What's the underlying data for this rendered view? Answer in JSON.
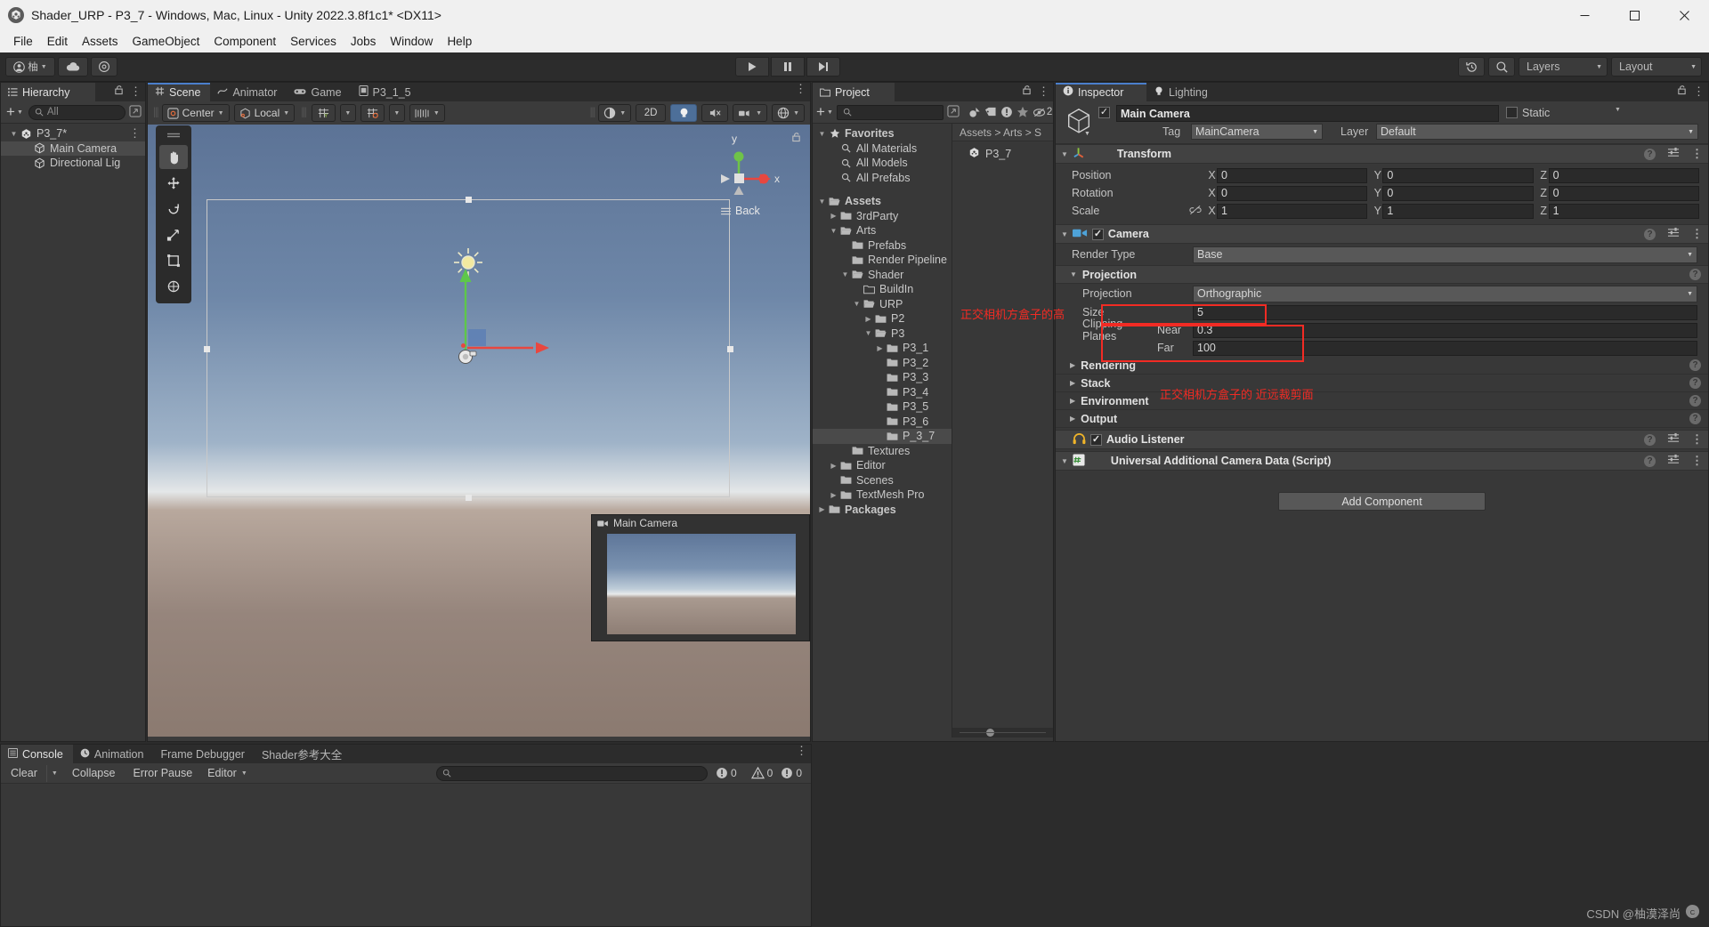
{
  "window": {
    "title": "Shader_URP - P3_7 - Windows, Mac, Linux - Unity 2022.3.8f1c1* <DX11>",
    "minimize": "—",
    "maximize": "❐",
    "close": "✕"
  },
  "menu": {
    "items": [
      "File",
      "Edit",
      "Assets",
      "GameObject",
      "Component",
      "Services",
      "Jobs",
      "Window",
      "Help"
    ]
  },
  "toolbar": {
    "account_icon": "account-icon",
    "account_label": "柚",
    "cloud_icon": "cloud-icon",
    "settings_icon": "gear-icon",
    "play_icon": "▶",
    "pause_icon": "❚❚",
    "step_icon": "▶❙",
    "history_icon": "undo-history-icon",
    "search_icon": "search-icon",
    "layers_label": "Layers",
    "layout_label": "Layout"
  },
  "hierarchy": {
    "tab_label": "Hierarchy",
    "lock_icon": "lock-icon",
    "menu_icon": "kebab-menu-icon",
    "add_label": "+",
    "search_placeholder": "All",
    "items": [
      {
        "label": "P3_7*",
        "icon": "unity-scene-icon",
        "depth": 0,
        "expanded": true,
        "selected": false
      },
      {
        "label": "Main Camera",
        "icon": "gameobject-icon",
        "depth": 1,
        "selected": true
      },
      {
        "label": "Directional Lig",
        "icon": "gameobject-icon",
        "depth": 1,
        "selected": false
      }
    ]
  },
  "scene": {
    "tabs": [
      {
        "label": "Scene",
        "icon": "scene-icon",
        "active": true
      },
      {
        "label": "Animator",
        "icon": "animator-icon",
        "active": false
      },
      {
        "label": "Game",
        "icon": "gamepad-icon",
        "active": false
      },
      {
        "label": "P3_1_5",
        "icon": "asset-icon",
        "active": false
      }
    ],
    "toolbar": {
      "pivot_label": "Center",
      "handle_label": "Local",
      "grid_icon": "grid-axis-icon",
      "snap_icon": "snap-increment-icon",
      "ruler_icon": "ruler-icon",
      "shading_icon": "shading-mode-icon",
      "two_d_label": "2D",
      "light_icon": "lightbulb-icon",
      "audio_icon": "audio-mute-icon",
      "fx_icon": "effects-icon",
      "gizmo_icon": "gizmo-visibility-icon",
      "camera_icon": "scene-camera-icon"
    },
    "tools": [
      "hand-tool",
      "move-tool",
      "rotate-tool",
      "scale-tool",
      "rect-tool",
      "transform-tool"
    ],
    "gizmo": {
      "x_label": "x",
      "y_label": "y",
      "view_label": "Back",
      "lock_icon": "lock-icon"
    },
    "preview": {
      "title": "Main Camera",
      "icon": "camera-icon"
    }
  },
  "project": {
    "tab_label": "Project",
    "lock_icon": "lock-icon",
    "menu_icon": "kebab-menu-icon",
    "add_label": "+",
    "search_placeholder": "",
    "filter_icons": [
      "asset-type-icon",
      "label-icon",
      "warning-icon",
      "favorite-star-icon",
      "hidden-count-icon"
    ],
    "hidden_count": "2",
    "breadcrumb": "Assets > Arts > S",
    "grid_items": [
      {
        "label": "P3_7",
        "icon": "unity-scene-icon"
      }
    ],
    "tree": [
      {
        "label": "Favorites",
        "depth": 0,
        "arrow": "down",
        "icon": "star-icon",
        "bold": true
      },
      {
        "label": "All Materials",
        "depth": 1,
        "arrow": "none",
        "icon": "search-icon"
      },
      {
        "label": "All Models",
        "depth": 1,
        "arrow": "none",
        "icon": "search-icon"
      },
      {
        "label": "All Prefabs",
        "depth": 1,
        "arrow": "none",
        "icon": "search-icon"
      },
      {
        "label": "",
        "depth": 0,
        "arrow": "none",
        "icon": "spacer"
      },
      {
        "label": "Assets",
        "depth": 0,
        "arrow": "down",
        "icon": "folder-open-icon",
        "bold": true
      },
      {
        "label": "3rdParty",
        "depth": 1,
        "arrow": "right",
        "icon": "folder-icon"
      },
      {
        "label": "Arts",
        "depth": 1,
        "arrow": "down",
        "icon": "folder-open-icon"
      },
      {
        "label": "Prefabs",
        "depth": 2,
        "arrow": "none",
        "icon": "folder-icon"
      },
      {
        "label": "Render Pipeline",
        "depth": 2,
        "arrow": "none",
        "icon": "folder-icon"
      },
      {
        "label": "Shader",
        "depth": 2,
        "arrow": "down",
        "icon": "folder-open-icon"
      },
      {
        "label": "BuildIn",
        "depth": 3,
        "arrow": "none",
        "icon": "folder-empty-icon"
      },
      {
        "label": "URP",
        "depth": 3,
        "arrow": "down",
        "icon": "folder-open-icon"
      },
      {
        "label": "P2",
        "depth": 4,
        "arrow": "right",
        "icon": "folder-icon"
      },
      {
        "label": "P3",
        "depth": 4,
        "arrow": "down",
        "icon": "folder-open-icon"
      },
      {
        "label": "P3_1",
        "depth": 5,
        "arrow": "right",
        "icon": "folder-icon"
      },
      {
        "label": "P3_2",
        "depth": 5,
        "arrow": "none",
        "icon": "folder-icon"
      },
      {
        "label": "P3_3",
        "depth": 5,
        "arrow": "none",
        "icon": "folder-icon"
      },
      {
        "label": "P3_4",
        "depth": 5,
        "arrow": "none",
        "icon": "folder-icon"
      },
      {
        "label": "P3_5",
        "depth": 5,
        "arrow": "none",
        "icon": "folder-icon"
      },
      {
        "label": "P3_6",
        "depth": 5,
        "arrow": "none",
        "icon": "folder-icon"
      },
      {
        "label": "P_3_7",
        "depth": 5,
        "arrow": "none",
        "icon": "folder-icon",
        "selected": true
      },
      {
        "label": "Textures",
        "depth": 2,
        "arrow": "none",
        "icon": "folder-icon"
      },
      {
        "label": "Editor",
        "depth": 1,
        "arrow": "right",
        "icon": "folder-icon"
      },
      {
        "label": "Scenes",
        "depth": 1,
        "arrow": "none",
        "icon": "folder-icon"
      },
      {
        "label": "TextMesh Pro",
        "depth": 1,
        "arrow": "right",
        "icon": "folder-icon"
      },
      {
        "label": "Packages",
        "depth": 0,
        "arrow": "right",
        "icon": "folder-icon",
        "bold": true
      }
    ]
  },
  "inspector": {
    "tabs": [
      {
        "label": "Inspector",
        "icon": "info-icon",
        "active": true
      },
      {
        "label": "Lighting",
        "icon": "lighting-icon",
        "active": false
      }
    ],
    "lock_icon": "lock-icon",
    "menu_icon": "kebab-menu-icon",
    "object_icon": "gameobject-cube-icon",
    "enabled": true,
    "name": "Main Camera",
    "static_label": "Static",
    "tag_label": "Tag",
    "tag_value": "MainCamera",
    "layer_label": "Layer",
    "layer_value": "Default",
    "transform": {
      "title": "Transform",
      "icon": "transform-axis-icon",
      "rows": [
        {
          "label": "Position",
          "x": "0",
          "y": "0",
          "z": "0"
        },
        {
          "label": "Rotation",
          "x": "0",
          "y": "0",
          "z": "0"
        },
        {
          "label": "Scale",
          "x": "1",
          "y": "1",
          "z": "1",
          "link_icon": "link-broken-icon"
        }
      ],
      "axis_labels": [
        "X",
        "Y",
        "Z"
      ]
    },
    "camera": {
      "title": "Camera",
      "icon": "camera-icon",
      "enabled": true,
      "render_type_label": "Render Type",
      "render_type_value": "Base",
      "projection_group_label": "Projection",
      "projection_label": "Projection",
      "projection_value": "Orthographic",
      "size_label": "Size",
      "size_value": "5",
      "clipping_label": "Clipping Planes",
      "near_label": "Near",
      "near_value": "0.3",
      "far_label": "Far",
      "far_value": "100",
      "foldouts": [
        "Rendering",
        "Stack",
        "Environment",
        "Output"
      ]
    },
    "audio_listener": {
      "title": "Audio Listener",
      "icon": "headphones-icon",
      "enabled": true
    },
    "script": {
      "title": "Universal Additional Camera Data (Script)",
      "icon": "script-icon"
    },
    "add_component_label": "Add Component"
  },
  "annotations": [
    {
      "text": "正交相机方盒子的高",
      "name": "annotation-ortho-size"
    },
    {
      "text": "正交相机方盒子的 近远裁剪面",
      "name": "annotation-clipping-planes"
    }
  ],
  "console": {
    "tabs": [
      {
        "label": "Console",
        "icon": "console-icon",
        "active": true
      },
      {
        "label": "Animation",
        "icon": "clock-icon",
        "active": false
      },
      {
        "label": "Frame Debugger",
        "icon": "",
        "active": false
      },
      {
        "label": "Shader参考大全",
        "icon": "",
        "active": false
      }
    ],
    "menu_icon": "kebab-menu-icon",
    "clear_label": "Clear",
    "collapse_label": "Collapse",
    "error_pause_label": "Error Pause",
    "editor_label": "Editor",
    "search_placeholder": "",
    "counts": {
      "log": "0",
      "warning": "0",
      "error": "0"
    }
  },
  "watermark": {
    "text": "CSDN @柚漠泽尚",
    "icon": "csdn-icon"
  },
  "colors": {
    "accent_blue": "#4b7fcc",
    "annotation_red": "#f22b24",
    "panel_bg": "#383838",
    "header_bg": "#424242",
    "chrome_bg": "#2c2c2c"
  }
}
